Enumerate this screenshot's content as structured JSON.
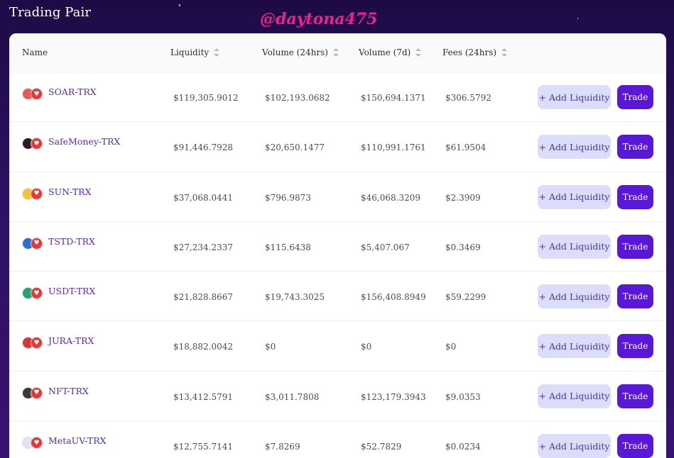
{
  "page": {
    "title": "Trading Pair",
    "watermark": "@daytona475"
  },
  "table": {
    "headers": {
      "name": "Name",
      "liquidity": "Liquidity",
      "volume24h": "Volume (24hrs)",
      "volume7d": "Volume (7d)",
      "fees24h": "Fees (24hrs)"
    },
    "add_label": "+ Add Liquidity",
    "trade_label": "Trade",
    "rows": [
      {
        "pair": "SOAR-TRX",
        "icon": "soar-token-icon",
        "icon_color": "#e85a5a",
        "liquidity": "$119,305.9012",
        "volume24h": "$102,193.0682",
        "volume7d": "$150,694.1371",
        "fees24h": "$306.5792"
      },
      {
        "pair": "SafeMoney-TRX",
        "icon": "safemoney-token-icon",
        "icon_color": "#2a1a2e",
        "liquidity": "$91,446.7928",
        "volume24h": "$20,650.1477",
        "volume7d": "$110,991.1761",
        "fees24h": "$61.9504"
      },
      {
        "pair": "SUN-TRX",
        "icon": "sun-token-icon",
        "icon_color": "#f2c23a",
        "liquidity": "$37,068.0441",
        "volume24h": "$796.9873",
        "volume7d": "$46,068.3209",
        "fees24h": "$2.3909"
      },
      {
        "pair": "TSTD-TRX",
        "icon": "tstd-token-icon",
        "icon_color": "#2c6fd1",
        "liquidity": "$27,234.2337",
        "volume24h": "$115.6438",
        "volume7d": "$5,407.067",
        "fees24h": "$0.3469"
      },
      {
        "pair": "USDT-TRX",
        "icon": "usdt-token-icon",
        "icon_color": "#26a17b",
        "liquidity": "$21,828.8667",
        "volume24h": "$19,743.3025",
        "volume7d": "$156,408.8949",
        "fees24h": "$59.2299"
      },
      {
        "pair": "JURA-TRX",
        "icon": "jura-token-icon",
        "icon_color": "#d93535",
        "liquidity": "$18,882.0042",
        "volume24h": "$0",
        "volume7d": "$0",
        "fees24h": "$0"
      },
      {
        "pair": "NFT-TRX",
        "icon": "nft-token-icon",
        "icon_color": "#3a3a3a",
        "liquidity": "$13,412.5791",
        "volume24h": "$3,011.7808",
        "volume7d": "$123,179.3943",
        "fees24h": "$9.0353"
      },
      {
        "pair": "MetaUV-TRX",
        "icon": "metauv-token-icon",
        "icon_color": "#e6e0f0",
        "liquidity": "$12,755.7141",
        "volume24h": "$7.8269",
        "volume7d": "$52.7829",
        "fees24h": "$0.0234"
      }
    ]
  }
}
